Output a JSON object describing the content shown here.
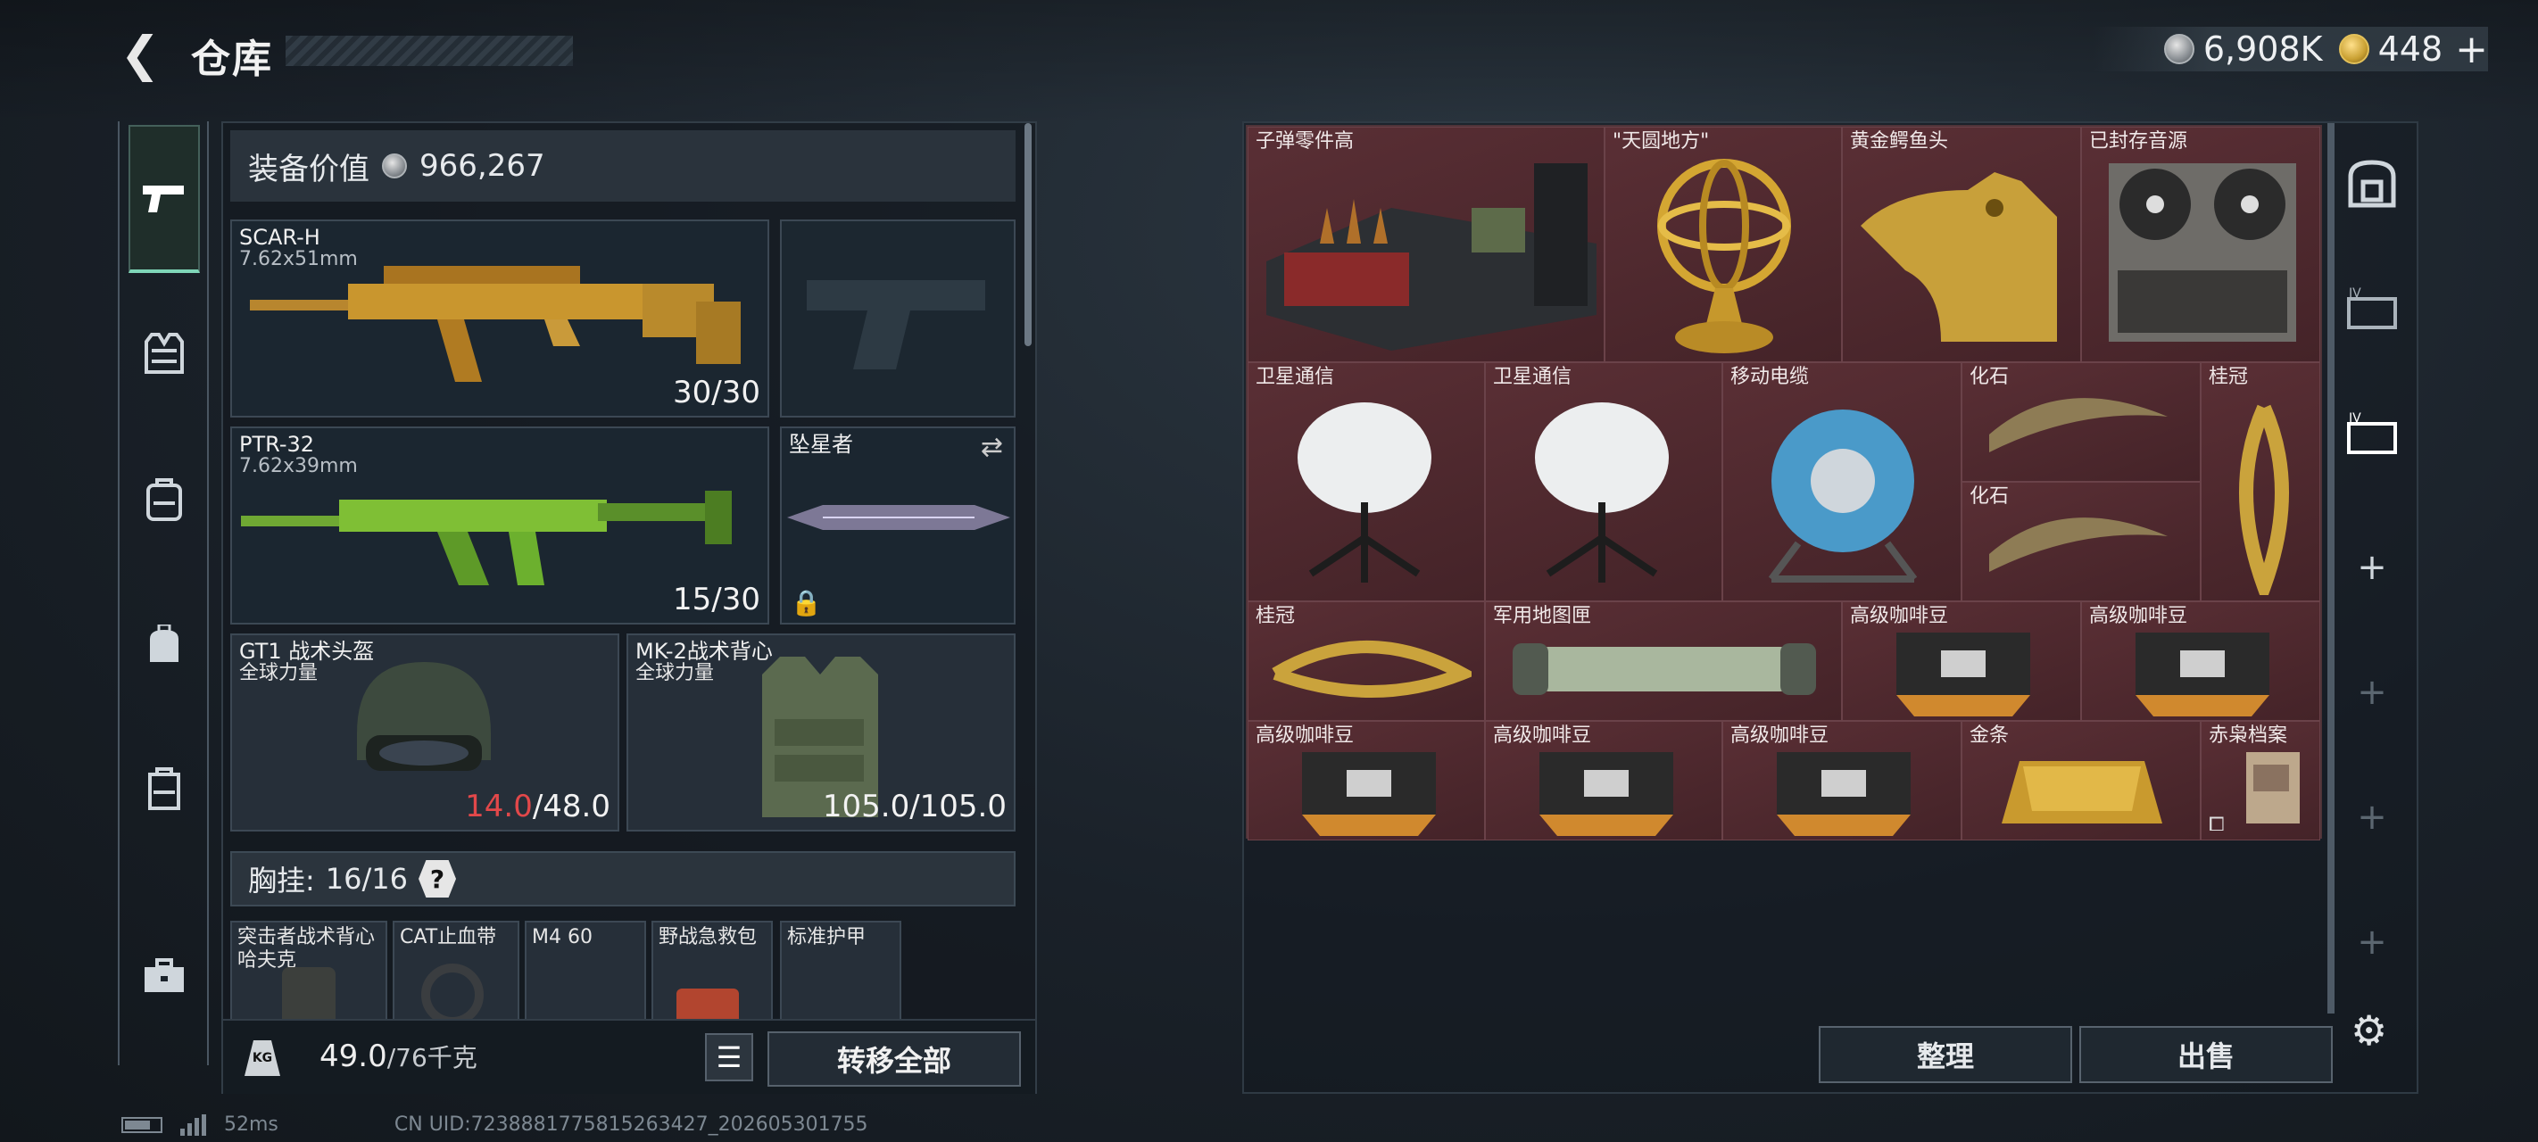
{
  "header": {
    "title": "仓库",
    "silver": "6,908K",
    "gold": "448"
  },
  "left_nav": [
    "pistol-icon",
    "vest-icon",
    "backpack-icon",
    "bag-icon",
    "case-icon",
    "toolbox-icon"
  ],
  "equipment_value": {
    "label": "装备价值",
    "value": "966,267"
  },
  "weapons": [
    {
      "name": "SCAR-H",
      "caliber": "7.62x51mm",
      "ammo": "30/30"
    },
    {
      "name": "PTR-32",
      "caliber": "7.62x39mm",
      "ammo": "15/30"
    }
  ],
  "melee": {
    "name": "坠星者"
  },
  "helmet": {
    "name": "GT1 战术头盔",
    "faction": "全球力量",
    "durability_current": "14.0",
    "durability_max": "/48.0"
  },
  "armor": {
    "name": "MK-2战术背心",
    "faction": "全球力量",
    "durability": "105.0/105.0"
  },
  "rig": {
    "label": "胸挂:",
    "count": "16/16",
    "help": "?"
  },
  "rig_items": [
    {
      "name": "突击者战术背心\n哈夫克"
    },
    {
      "name": "CAT止血带"
    },
    {
      "name": "M4 60"
    },
    {
      "name": "野战急救包"
    },
    {
      "name": "标准护甲"
    }
  ],
  "weight": {
    "icon": "KG",
    "current": "49.0",
    "max": "/76千克"
  },
  "buttons": {
    "transfer_all": "转移全部",
    "sort": "整理",
    "sell": "出售"
  },
  "stash_items": [
    {
      "name": "子弹零件高"
    },
    {
      "name": "\"天圆地方\""
    },
    {
      "name": "黄金鳄鱼头"
    },
    {
      "name": "已封存音源"
    },
    {
      "name": "卫星通信"
    },
    {
      "name": "卫星通信"
    },
    {
      "name": "移动电缆"
    },
    {
      "name": "化石"
    },
    {
      "name": "桂冠"
    },
    {
      "name": "化石"
    },
    {
      "name": "桂冠"
    },
    {
      "name": "军用地图匣"
    },
    {
      "name": "高级咖啡豆"
    },
    {
      "name": "高级咖啡豆"
    },
    {
      "name": "高级咖啡豆"
    },
    {
      "name": "高级咖啡豆"
    },
    {
      "name": "高级咖啡豆"
    },
    {
      "name": "金条"
    },
    {
      "name": "赤枭档案"
    }
  ],
  "right_nav": [
    "safe-icon",
    "tier4-case-icon",
    "tier4-case-icon",
    "add-icon",
    "add-icon",
    "add-icon",
    "add-icon"
  ],
  "footer": {
    "ping": "52ms",
    "uid": "CN UID:7238881775815263427_202605301755"
  },
  "colors": {
    "rare_red": "#5a2f35",
    "low_durability": "#e2484a",
    "active_nav": "#7fd6b8"
  }
}
